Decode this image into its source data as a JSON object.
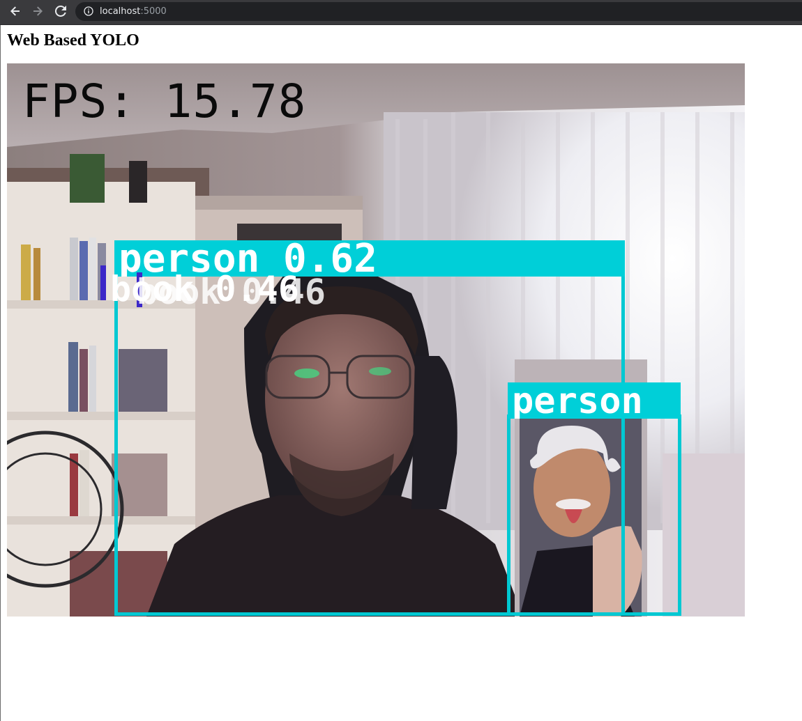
{
  "browser": {
    "url_host": "localhost",
    "url_port": ":5000",
    "back_icon": "back-arrow-icon",
    "forward_icon": "forward-arrow-icon",
    "reload_icon": "reload-icon",
    "info_icon": "info-icon"
  },
  "page": {
    "title": "Web Based YOLO"
  },
  "stream": {
    "fps_text": "FPS: 15.78",
    "detections": [
      {
        "label": "person 0.62",
        "color": "#00c8d2"
      },
      {
        "label": "person",
        "color": "#00c8d2"
      },
      {
        "label": "book 0.46",
        "color": "#3c28c8"
      },
      {
        "label": "book 0.46",
        "color": "#3c28c8"
      }
    ]
  }
}
